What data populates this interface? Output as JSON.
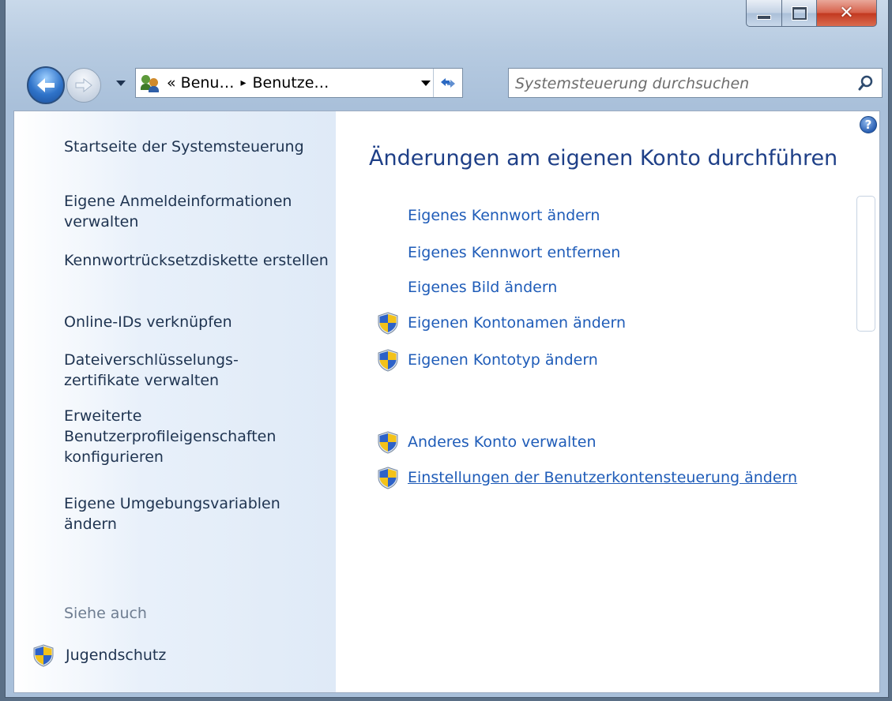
{
  "window": {
    "caption_buttons": {
      "minimize": "minimize",
      "maximize": "maximize",
      "close": "close"
    }
  },
  "nav": {
    "breadcrumb": [
      "« Benu…",
      "Benutze…"
    ],
    "separator": "▸",
    "search_placeholder": "Systemsteuerung durchsuchen"
  },
  "sidebar": {
    "items": [
      "Startseite der Systemsteuerung",
      "Eigene Anmeldeinformationen verwalten",
      "Kennwortrücksetzdiskette erstellen",
      "Online-IDs verknüpfen",
      "Dateiverschlüsselungs-zertifikate verwalten",
      "Erweiterte Benutzerprofileigenschaften konfigurieren",
      "Eigene Umgebungsvariablen ändern"
    ],
    "see_also_label": "Siehe auch",
    "see_also_items": [
      "Jugendschutz"
    ]
  },
  "main": {
    "help_glyph": "?",
    "title": "Änderungen am eigenen Konto durchführen",
    "tasks": [
      "Eigenes Kennwort ändern",
      "Eigenes Kennwort entfernen",
      "Eigenes Bild ändern",
      "Eigenen Kontonamen ändern",
      "Eigenen Kontotyp ändern"
    ],
    "other_tasks": [
      "Anderes Konto verwalten",
      "Einstellungen der Benutzerkontensteuerung ändern"
    ]
  },
  "colors": {
    "link": "#1f5cb8",
    "title": "#1e3f87",
    "sidebar_text": "#1e3350",
    "muted": "#6e7d91"
  }
}
